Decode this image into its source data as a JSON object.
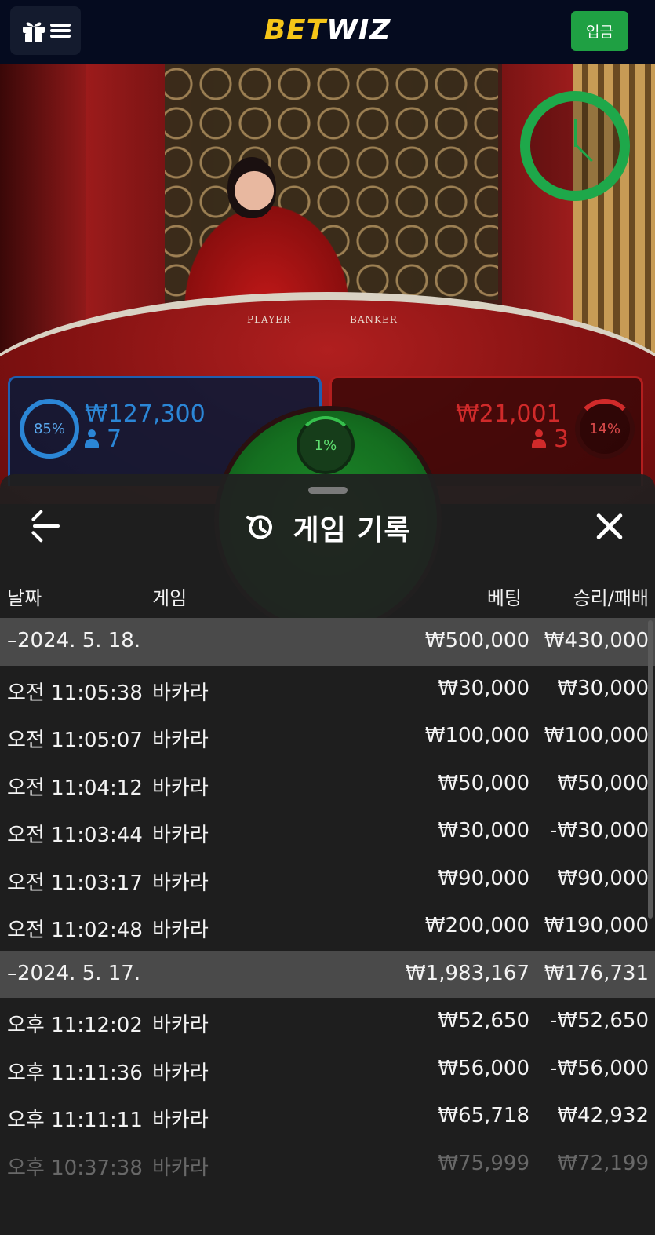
{
  "header": {
    "logo_part1": "BET",
    "logo_part2": "WIZ",
    "deposit_label": "입금",
    "menu_icon": "gift-menu-icon"
  },
  "game": {
    "player": {
      "percent": "85%",
      "amount": "₩127,300",
      "count": "7"
    },
    "banker": {
      "percent": "14%",
      "amount": "₩21,001",
      "count": "3"
    },
    "tie": {
      "percent": "1%"
    },
    "table_labels": {
      "player": "PLAYER",
      "banker": "BANKER"
    }
  },
  "history": {
    "title": "게임 기록",
    "columns": {
      "date": "날짜",
      "game": "게임",
      "bet": "베팅",
      "result": "승리/패배"
    },
    "rows": [
      {
        "type": "date",
        "time": "–2024. 5. 18.",
        "game": "",
        "bet": "₩500,000",
        "result": "₩430,000"
      },
      {
        "type": "item",
        "time": "오전 11:05:38",
        "game": "바카라",
        "bet": "₩30,000",
        "result": "₩30,000"
      },
      {
        "type": "item",
        "time": "오전 11:05:07",
        "game": "바카라",
        "bet": "₩100,000",
        "result": "₩100,000"
      },
      {
        "type": "item",
        "time": "오전 11:04:12",
        "game": "바카라",
        "bet": "₩50,000",
        "result": "₩50,000"
      },
      {
        "type": "item",
        "time": "오전 11:03:44",
        "game": "바카라",
        "bet": "₩30,000",
        "result": "-₩30,000"
      },
      {
        "type": "item",
        "time": "오전 11:03:17",
        "game": "바카라",
        "bet": "₩90,000",
        "result": "₩90,000"
      },
      {
        "type": "item",
        "time": "오전 11:02:48",
        "game": "바카라",
        "bet": "₩200,000",
        "result": "₩190,000"
      },
      {
        "type": "date",
        "time": "–2024. 5. 17.",
        "game": "",
        "bet": "₩1,983,167",
        "result": "₩176,731"
      },
      {
        "type": "item",
        "time": "오후 11:12:02",
        "game": "바카라",
        "bet": "₩52,650",
        "result": "-₩52,650"
      },
      {
        "type": "item",
        "time": "오후 11:11:36",
        "game": "바카라",
        "bet": "₩56,000",
        "result": "-₩56,000"
      },
      {
        "type": "item",
        "time": "오후 11:11:11",
        "game": "바카라",
        "bet": "₩65,718",
        "result": "₩42,932"
      },
      {
        "type": "item",
        "time": "오후 10:37:38",
        "game": "바카라",
        "bet": "₩75,999",
        "result": "₩72,199"
      }
    ]
  },
  "colors": {
    "accent_gold": "#f5c518",
    "deposit_green": "#1fa043",
    "player_blue": "#2b86d6",
    "banker_red": "#d02a2a",
    "tie_green": "#1ea84a"
  }
}
